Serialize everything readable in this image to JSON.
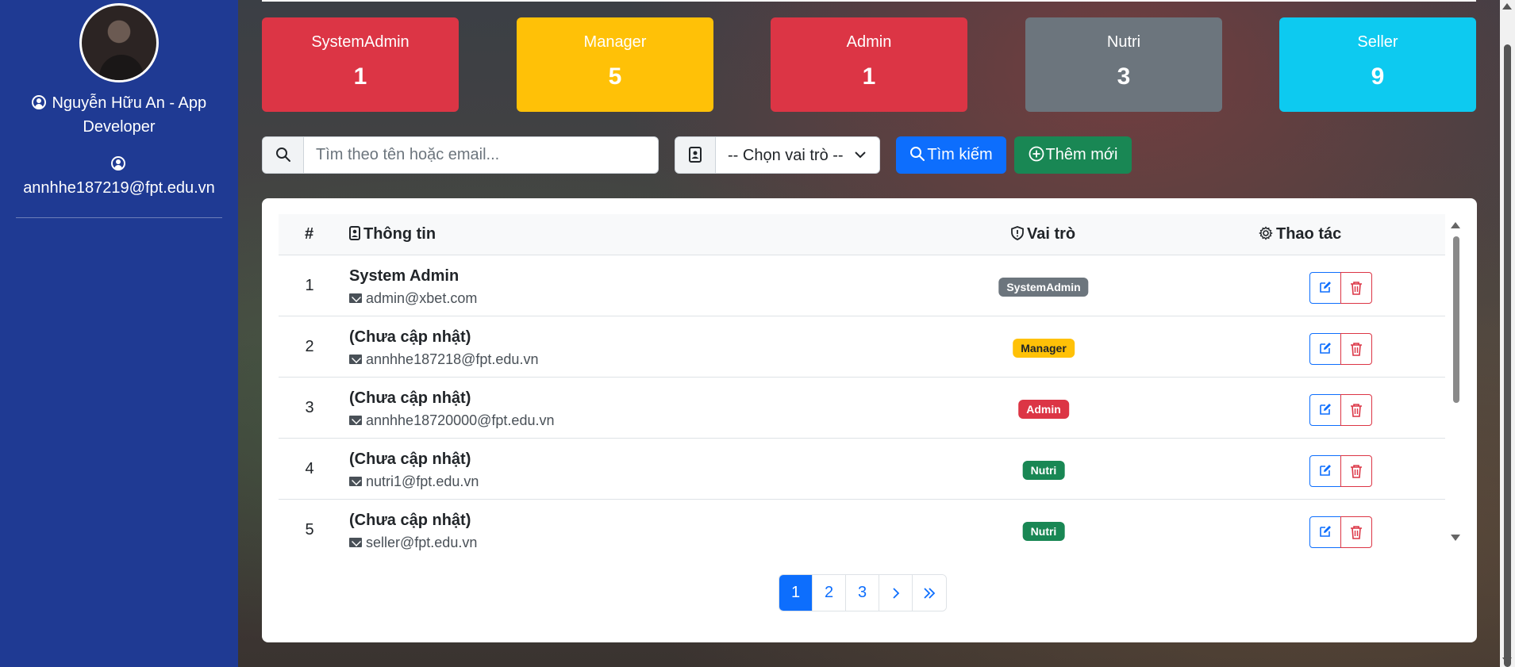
{
  "sidebar": {
    "user_name": "Nguyễn Hữu An - App Developer",
    "email": "annhhe187219@fpt.edu.vn"
  },
  "stats": [
    {
      "title": "SystemAdmin",
      "count": "1",
      "color": "#dc3545"
    },
    {
      "title": "Manager",
      "count": "5",
      "color": "#ffc107"
    },
    {
      "title": "Admin",
      "count": "1",
      "color": "#dc3545"
    },
    {
      "title": "Nutri",
      "count": "3",
      "color": "#6c757d"
    },
    {
      "title": "Seller",
      "count": "9",
      "color": "#0dcaf0"
    }
  ],
  "search": {
    "placeholder": "Tìm theo tên hoặc email...",
    "role_select": "-- Chọn vai trò --",
    "search_button": "Tìm kiếm",
    "add_button": "Thêm mới"
  },
  "table": {
    "headers": {
      "num": "#",
      "info": "Thông tin",
      "role": "Vai trò",
      "actions": "Thao tác"
    },
    "rows": [
      {
        "num": "1",
        "name": "System Admin",
        "email": "admin@xbet.com",
        "role": "SystemAdmin",
        "role_color": "#6c757d"
      },
      {
        "num": "2",
        "name": "(Chưa cập nhật)",
        "email": "annhhe187218@fpt.edu.vn",
        "role": "Manager",
        "role_color": "#ffc107"
      },
      {
        "num": "3",
        "name": "(Chưa cập nhật)",
        "email": "annhhe18720000@fpt.edu.vn",
        "role": "Admin",
        "role_color": "#dc3545"
      },
      {
        "num": "4",
        "name": "(Chưa cập nhật)",
        "email": "nutri1@fpt.edu.vn",
        "role": "Nutri",
        "role_color": "#198754"
      },
      {
        "num": "5",
        "name": "(Chưa cập nhật)",
        "email": "seller@fpt.edu.vn",
        "role": "Nutri",
        "role_color": "#198754"
      }
    ]
  },
  "pagination": {
    "pages": [
      "1",
      "2",
      "3"
    ],
    "active_page": "1",
    "next_icon": "chevron-right-icon",
    "last_icon": "chevrons-right-icon"
  },
  "colors": {
    "sidebar_bg": "#1f3a93",
    "primary": "#0d6efd",
    "success": "#198754"
  }
}
